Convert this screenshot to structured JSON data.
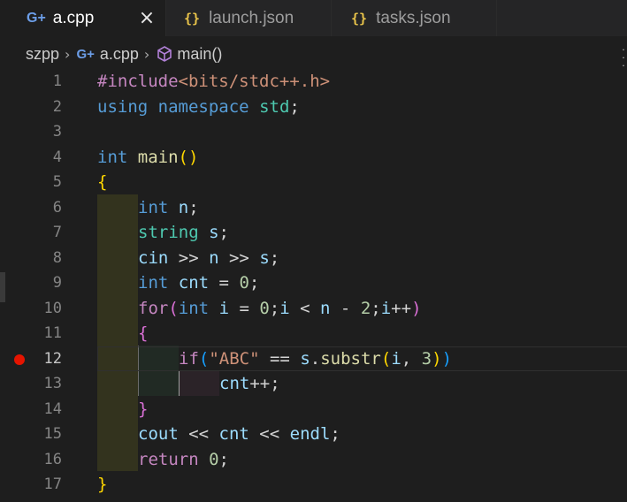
{
  "tabs": [
    {
      "icon": "cpp-icon",
      "label": "a.cpp",
      "active": true
    },
    {
      "icon": "json-icon",
      "label": "launch.json",
      "active": false
    },
    {
      "icon": "json-icon",
      "label": "tasks.json",
      "active": false
    }
  ],
  "icons": {
    "cpp_glyph": "G+",
    "json_glyph": "{}",
    "close_glyph": "×",
    "chevron": "›"
  },
  "breadcrumb": {
    "folder": "szpp",
    "file": "a.cpp",
    "symbol": "main()"
  },
  "editor": {
    "breakpoint_line": 12,
    "current_line": 12,
    "line_numbers": [
      "1",
      "2",
      "3",
      "4",
      "5",
      "6",
      "7",
      "8",
      "9",
      "10",
      "11",
      "12",
      "13",
      "14",
      "15",
      "16",
      "17"
    ],
    "code": {
      "l1_pp": "#include",
      "l1_inc": "<bits/stdc++.h>",
      "l2_using": "using",
      "l2_ns": "namespace",
      "l2_std": "std",
      "l2_semi": ";",
      "l4_int": "int",
      "l4_main": "main",
      "l4_parens": "()",
      "l5_brace": "{",
      "l6_int": "int",
      "l6_n": "n",
      "l6_semi": ";",
      "l7_string": "string",
      "l7_s": "s",
      "l7_semi": ";",
      "l8_cin": "cin",
      "l8_op1": " >> ",
      "l8_n": "n",
      "l8_op2": " >> ",
      "l8_s": "s",
      "l8_semi": ";",
      "l9_int": "int",
      "l9_cnt": "cnt",
      "l9_eq": " = ",
      "l9_zero": "0",
      "l9_semi": ";",
      "l10_for": "for",
      "l10_lp": "(",
      "l10_int": "int",
      "l10_i": "i",
      "l10_eq": " = ",
      "l10_zero": "0",
      "l10_semi1": ";",
      "l10_i2": "i",
      "l10_lt": " < ",
      "l10_n": "n",
      "l10_minus": " - ",
      "l10_two": "2",
      "l10_semi2": ";",
      "l10_i3": "i",
      "l10_inc": "++",
      "l10_rp": ")",
      "l11_brace": "{",
      "l12_if": "if",
      "l12_lp": "(",
      "l12_str": "\"ABC\"",
      "l12_eqeq": " == ",
      "l12_s": "s",
      "l12_dot": ".",
      "l12_substr": "substr",
      "l12_lp2": "(",
      "l12_i": "i",
      "l12_comma": ", ",
      "l12_three": "3",
      "l12_rp2": ")",
      "l12_rp": ")",
      "l13_cnt": "cnt",
      "l13_inc": "++;",
      "l14_brace": "}",
      "l15_cout": "cout",
      "l15_op1": " << ",
      "l15_cnt": "cnt",
      "l15_op2": " << ",
      "l15_endl": "endl",
      "l15_semi": ";",
      "l16_return": "return",
      "l16_zero": "0",
      "l16_semi": ";",
      "l17_brace": "}"
    }
  }
}
